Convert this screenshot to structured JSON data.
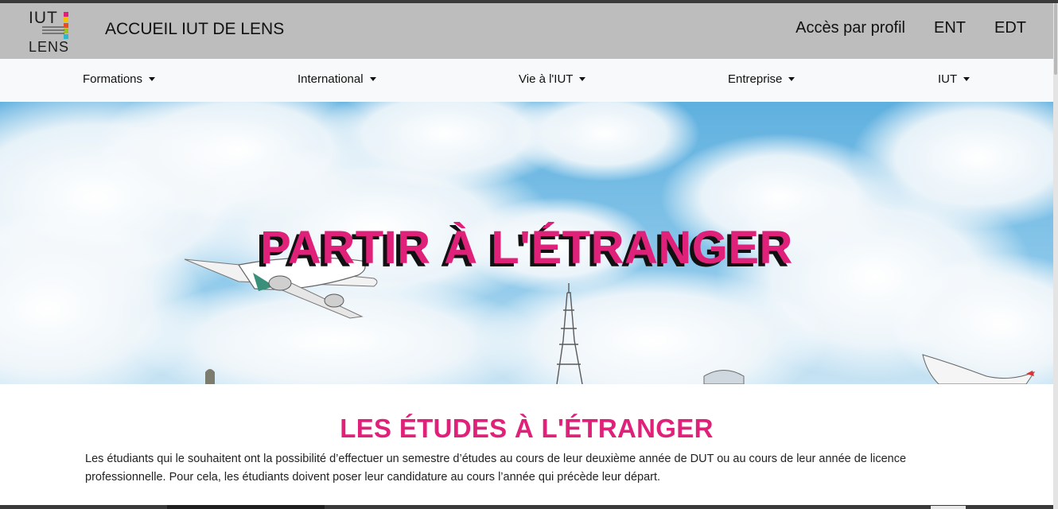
{
  "header": {
    "logo_top": "IUT",
    "logo_bottom": "LENS",
    "site_title": "ACCUEIL IUT DE LENS",
    "links": [
      "Accès par profil",
      "ENT",
      "EDT"
    ]
  },
  "nav": {
    "items": [
      {
        "label": "Formations"
      },
      {
        "label": "International"
      },
      {
        "label": "Vie à l'IUT"
      },
      {
        "label": "Entreprise"
      },
      {
        "label": "IUT"
      }
    ]
  },
  "hero": {
    "title": "PARTIR À L'ÉTRANGER",
    "image": "sky-airplanes-eiffel-tower"
  },
  "content": {
    "section_title": "LES ÉTUDES À L'ÉTRANGER",
    "intro": "Les étudiants qui le souhaitent ont la possibilité d’effectuer un semestre d’études au cours de leur deuxième année de DUT ou au cours de leur année de licence professionnelle. Pour cela, les étudiants doivent poser leur candidature au cours l’année qui précède leur départ."
  },
  "colors": {
    "accent": "#e0217a",
    "header_bg": "#bdbdbd",
    "nav_bg": "#f8f9fa"
  }
}
